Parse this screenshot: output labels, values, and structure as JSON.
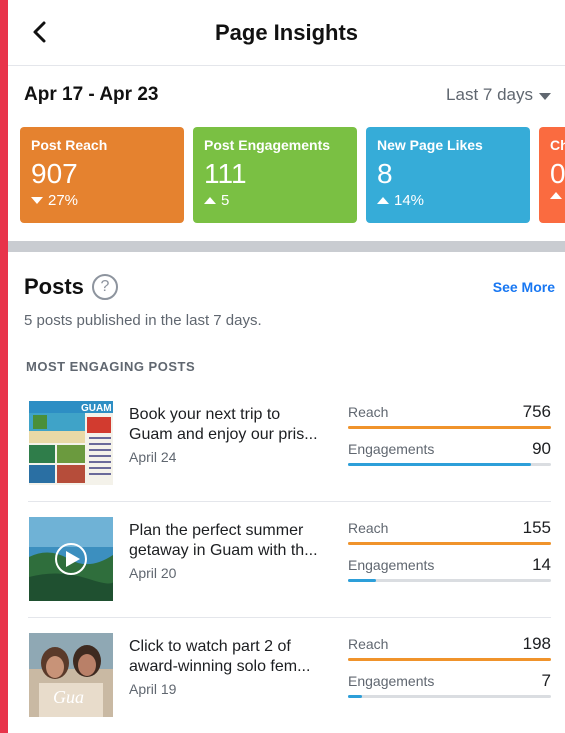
{
  "header": {
    "title": "Page Insights",
    "back_icon": "chevron-left-icon"
  },
  "date_row": {
    "range": "Apr 17 - Apr 23",
    "period": "Last 7 days"
  },
  "cards": [
    {
      "label": "Post Reach",
      "value": "907",
      "change": "27%",
      "direction": "down",
      "color": "#e5822f"
    },
    {
      "label": "Post Engagements",
      "value": "111",
      "change": "5",
      "direction": "up",
      "color": "#7ac043"
    },
    {
      "label": "New Page Likes",
      "value": "8",
      "change": "14%",
      "direction": "up",
      "color": "#36acd8"
    },
    {
      "label": "Ch",
      "value": "0",
      "change": "",
      "direction": "up",
      "color": "#fa6b40"
    }
  ],
  "posts": {
    "title": "Posts",
    "help_icon": "question-circle-icon",
    "see_more": "See More",
    "subtitle": "5 posts published in the last 7 days.",
    "section_label": "MOST ENGAGING POSTS",
    "reach_label": "Reach",
    "engagements_label": "Engagements",
    "reach_color": "#f0932b",
    "engagements_color": "#2d9fd9",
    "items": [
      {
        "line1": "Book your next trip to",
        "line2": "Guam and enjoy our pris...",
        "date": "April 24",
        "reach": "756",
        "engagements": "90",
        "reach_fill": 1.0,
        "engagements_fill": 0.9
      },
      {
        "line1": "Plan the perfect summer",
        "line2": "getaway in Guam with th...",
        "date": "April 20",
        "reach": "155",
        "engagements": "14",
        "reach_fill": 1.0,
        "engagements_fill": 0.14
      },
      {
        "line1": "Click to watch part 2 of",
        "line2": "award-winning solo fem...",
        "date": "April 19",
        "reach": "198",
        "engagements": "7",
        "reach_fill": 1.0,
        "engagements_fill": 0.07
      }
    ]
  }
}
